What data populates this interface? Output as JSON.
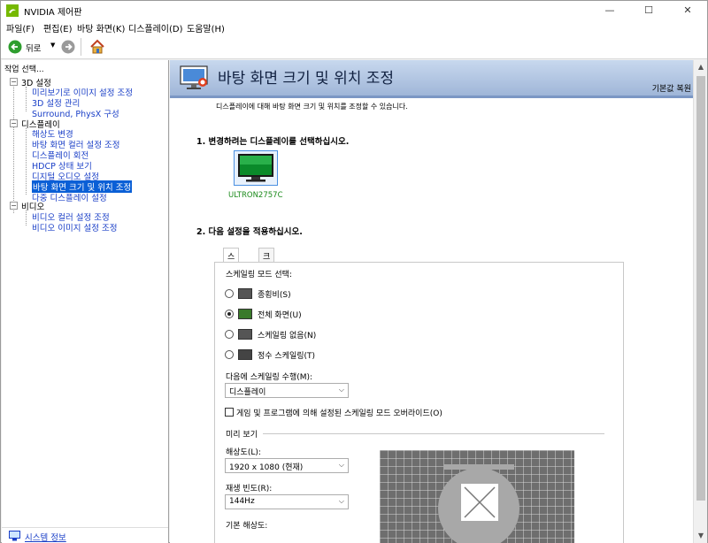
{
  "window": {
    "title": "NVIDIA 제어판",
    "min": "—",
    "max": "☐",
    "close": "✕"
  },
  "menu": [
    "파일(F)",
    "편집(E)",
    "바탕 화면(K)",
    "디스플레이(D)",
    "도움말(H)"
  ],
  "toolbar": {
    "back_label": "뒤로"
  },
  "sidebar": {
    "header": "작업 선택...",
    "categories": [
      {
        "label": "3D 설정",
        "items": [
          "미리보기로 이미지 설정 조정",
          "3D 설정 관리",
          "Surround, PhysX 구성"
        ]
      },
      {
        "label": "디스플레이",
        "items": [
          "해상도 변경",
          "바탕 화면 컬러 설정 조정",
          "디스플레이 회전",
          "HDCP 상태 보기",
          "디지털 오디오 설정",
          "바탕 화면 크기 및 위치 조정",
          "다중 디스플레이 설정"
        ]
      },
      {
        "label": "비디오",
        "items": [
          "비디오 컬러 설정 조정",
          "비디오 이미지 설정 조정"
        ]
      }
    ],
    "selected": "바탕 화면 크기 및 위치 조정",
    "system_info": "시스템 정보"
  },
  "page": {
    "title": "바탕 화면 크기 및 위치 조정",
    "restore_defaults": "기본값 복원",
    "description": "디스플레이에 대해 바탕 화면 크기 및 위치를 조정할 수 있습니다.",
    "step1": "1. 변경하려는 디스플레이를 선택하십시오.",
    "display_name": "ULTRON2757C",
    "step2": "2. 다음 설정을 적용하십시오.",
    "tabs": [
      "스케일링",
      "크기"
    ],
    "scaling_mode_label": "스케일링 모드 선택:",
    "modes": [
      "종횡비(S)",
      "전체 화면(U)",
      "스케일링 없음(N)",
      "정수 스케일링(T)"
    ],
    "selected_mode": "전체 화면(U)",
    "perform_on_label": "다음에 스케일링 수행(M):",
    "perform_on_value": "디스플레이",
    "override_label": "게임 및 프로그램에 의해 설정된 스케일링 모드 오버라이드(O)",
    "preview_label": "미리 보기",
    "resolution_label": "해상도(L):",
    "resolution_value": "1920 x 1080 (현재)",
    "refresh_label": "재생 빈도(R):",
    "refresh_value": "144Hz",
    "native_label": "기본 해상도:"
  },
  "colors": {
    "accent": "#0a5fd6",
    "nvidia_green": "#76b900",
    "link": "#1a3fc7"
  }
}
